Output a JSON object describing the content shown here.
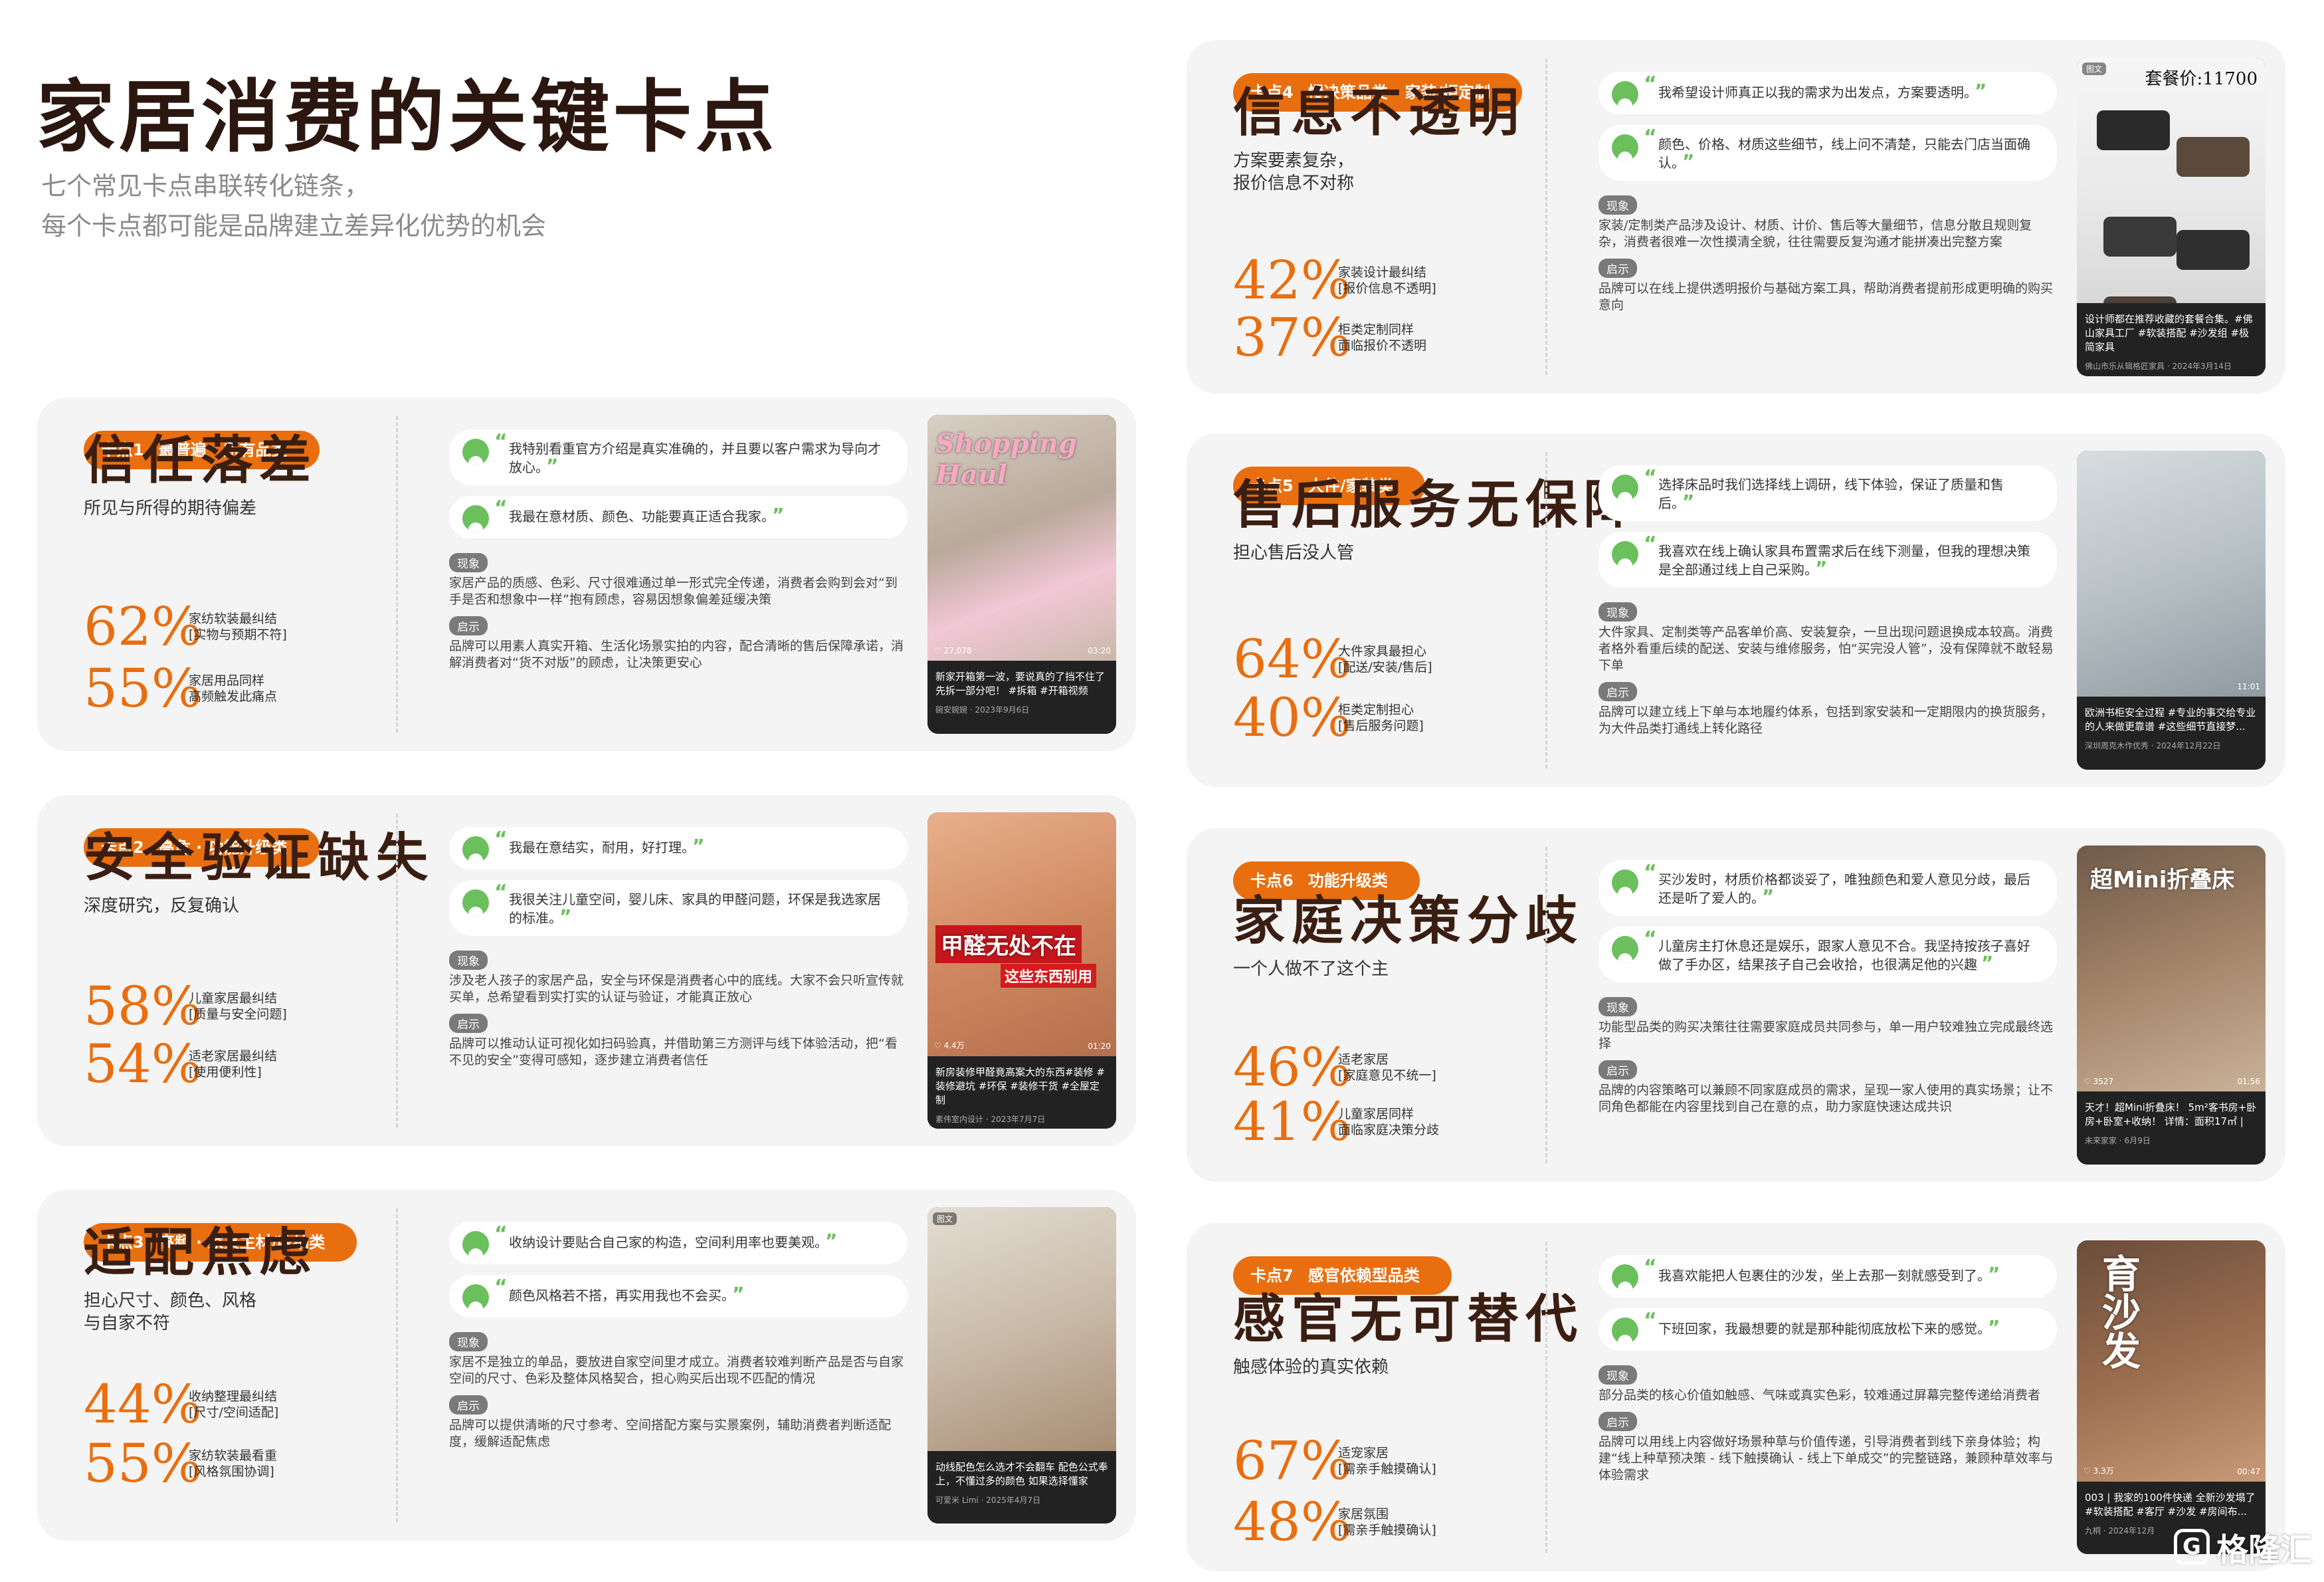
{
  "header": {
    "title": "家居消费的关键卡点",
    "subtitle_line1": "七个常见卡点串联转化链条，",
    "subtitle_line2": "每个卡点都可能是品牌建立差异化优势的机会"
  },
  "labels": {
    "phenomenon": "现象",
    "insight": "启示"
  },
  "cards": [
    {
      "tag_num": "卡点1",
      "tag_cat": "最普遍 · 所有品类",
      "name": "信任落差",
      "sub": "所见与所得的期待偏差",
      "stats": [
        {
          "pct": "62%",
          "desc": "家纺软装最纠结\n[实物与预期不符]"
        },
        {
          "pct": "55%",
          "desc": "家居用品同样\n高频触发此痛点"
        }
      ],
      "quotes": [
        "我特别看重官方介绍是真实准确的，并且要以客户需求为导向才放心。",
        "我最在意材质、颜色、功能要真正适合我家。"
      ],
      "phenomenon": "家居产品的质感、色彩、尺寸很难通过单一形式完全传递，消费者会购到会对“到手是否和想象中一样”抱有顾虑，容易因想象偏差延缓决策",
      "insight": "品牌可以用素人真实开箱、生活化场景实拍的内容，配合清晰的售后保障承诺，消解消费者对“货不对版”的顾虑，让决策更安心",
      "thumb": {
        "overlay": "Shopping Haul",
        "caption": "新家开箱第一波，要说真的了挡不住了先拆一部分吧！ #拆箱 #开箱视频",
        "meta": "碗安婉婉 · 2023年9月6日",
        "duration": "03:20",
        "likes": "27,078"
      }
    },
    {
      "tag_num": "卡点2",
      "tag_cat": "高危 · 功能升级类",
      "name": "安全验证缺失",
      "sub": "深度研究，反复确认",
      "stats": [
        {
          "pct": "58%",
          "desc": "儿童家居最纠结\n[质量与安全问题]"
        },
        {
          "pct": "54%",
          "desc": "适老家居最纠结\n[使用便利性]"
        }
      ],
      "quotes": [
        "我最在意结实，耐用，好打理。",
        "我很关注儿童空间，婴儿床、家具的甲醛问题，环保是我选家居的标准。"
      ],
      "phenomenon": "涉及老人孩子的家居产品，安全与环保是消费者心中的底线。大家不会只听宣传就买单，总希望看到实打实的认证与验证，才能真正放心",
      "insight": "品牌可以推动认证可视化如扫码验真，并借助第三方测评与线下体验活动，把“看不见的安全”变得可感知，逐步建立消费者信任",
      "thumb": {
        "overlay": "甲醛无处不在",
        "overlay2": "这些东西别用",
        "caption": "新房装修甲醛竟高案大的东西#装修 #装修避坑 #环保 #装修干货 #全屋定制",
        "meta": "素伟室内设计 · 2023年7月7日",
        "duration": "01:20",
        "likes": "4.4万"
      }
    },
    {
      "tag_num": "卡点3",
      "tag_cat": "高频 · 家具主材/收纳类",
      "name": "适配焦虑",
      "sub": "担心尺寸、颜色、风格\n与自家不符",
      "stats": [
        {
          "pct": "44%",
          "desc": "收纳整理最纠结\n[尺寸/空间适配]"
        },
        {
          "pct": "55%",
          "desc": "家纺软装最看重\n[风格氛围协调]"
        }
      ],
      "quotes": [
        "收纳设计要贴合自己家的构造，空间利用率也要美观。",
        "颜色风格若不搭，再实用我也不会买。"
      ],
      "phenomenon": "家居不是独立的单品，要放进自家空间里才成立。消费者较难判断产品是否与自家空间的尺寸、色彩及整体风格契合，担心购买后出现不匹配的情况",
      "insight": "品牌可以提供清晰的尺寸参考、空间搭配方案与实景案例，辅助消费者判断适配度，缓解适配焦虑",
      "thumb": {
        "badge": "图文",
        "caption": "动线配色怎么选才不会翻车 配色公式奉上，不懂过多的颜色 如果选择懂家",
        "meta": "可爱米 Limi · 2025年4月7日",
        "duration": "",
        "likes": ""
      }
    },
    {
      "tag_num": "卡点4",
      "tag_cat": "慢决策品类 · 家装/柜定制",
      "name": "信息不透明",
      "sub": "方案要素复杂，\n报价信息不对称",
      "stats": [
        {
          "pct": "42%",
          "desc": "家装设计最纠结\n[报价信息不透明]"
        },
        {
          "pct": "37%",
          "desc": "柜类定制同样\n面临报价不透明"
        }
      ],
      "quotes": [
        "我希望设计师真正以我的需求为出发点，方案要透明。",
        "颜色、价格、材质这些细节，线上问不清楚，只能去门店当面确认。"
      ],
      "phenomenon": "家装/定制类产品涉及设计、材质、计价、售后等大量细节，信息分散且规则复杂，消费者很难一次性摸清全貌，往往需要反复沟通才能拼凑出完整方案",
      "insight": "品牌可以在线上提供透明报价与基础方案工具，帮助消费者提前形成更明确的购买意向",
      "thumb": {
        "badge": "图文",
        "price": "套餐价:11700",
        "caption": "设计师都在推荐收藏的套餐合集。#佛山家具工厂 #软装搭配 #沙发组 #极简家具",
        "meta": "佛山市乐从辑格匠家具 · 2024年3月14日",
        "duration": "",
        "likes": ""
      }
    },
    {
      "tag_num": "卡点5",
      "tag_cat": "大件/家装类",
      "name": "售后服务无保障",
      "sub": "担心售后没人管",
      "stats": [
        {
          "pct": "64%",
          "desc": "大件家具最担心\n[配送/安装/售后]"
        },
        {
          "pct": "40%",
          "desc": "柜类定制担心\n[售后服务问题]"
        }
      ],
      "quotes": [
        "选择床品时我们选择线上调研，线下体验，保证了质量和售后。",
        "我喜欢在线上确认家具布置需求后在线下测量，但我的理想决策是全部通过线上自己采购。"
      ],
      "phenomenon": "大件家具、定制类等产品客单价高、安装复杂，一旦出现问题退换成本较高。消费者格外看重后续的配送、安装与维修服务，怕“买完没人管”，没有保障就不敢轻易下单",
      "insight": "品牌可以建立线上下单与本地履约体系，包括到家安装和一定期限内的换货服务，为大件品类打通线上转化路径",
      "thumb": {
        "caption": "欧洲书柜安全过程 #专业的事交给专业的人来做更靠谱 #这些细节直接梦...",
        "meta": "深圳周克木作优秀 · 2024年12月22日",
        "duration": "11:01",
        "likes": ""
      }
    },
    {
      "tag_num": "卡点6",
      "tag_cat": "功能升级类",
      "name": "家庭决策分歧",
      "sub": "一个人做不了这个主",
      "stats": [
        {
          "pct": "46%",
          "desc": "适老家居\n[家庭意见不统一]"
        },
        {
          "pct": "41%",
          "desc": "儿童家居同样\n面临家庭决策分歧"
        }
      ],
      "quotes": [
        "买沙发时，材质价格都谈妥了，唯独颜色和爱人意见分歧，最后还是听了爱人的。",
        "儿童房主打休息还是娱乐，跟家人意见不合。我坚持按孩子喜好做了手办区，结果孩子自己会收拾，也很满足他的兴趣"
      ],
      "phenomenon": "功能型品类的购买决策往往需要家庭成员共同参与，单一用户较难独立完成最终选择",
      "insight": "品牌的内容策略可以兼顾不同家庭成员的需求，呈现一家人使用的真实场景；让不同角色都能在内容里找到自己在意的点，助力家庭快速达成共识",
      "thumb": {
        "overlay": "超Mini折叠床",
        "caption": "天才！超Mini折叠床！ 5m²客书房+卧房+卧室+收纳！ 详情：面积17㎡ |",
        "meta": "未来家家 · 6月9日",
        "duration": "01:56",
        "likes": "3527"
      }
    },
    {
      "tag_num": "卡点7",
      "tag_cat": "感官依赖型品类",
      "name": "感官无可替代",
      "sub": "触感体验的真实依赖",
      "stats": [
        {
          "pct": "67%",
          "desc": "适宠家居\n[需亲手触摸确认]"
        },
        {
          "pct": "48%",
          "desc": "家居氛围\n[需亲手触摸确认]"
        }
      ],
      "quotes": [
        "我喜欢能把人包裹住的沙发，坐上去那一刻就感受到了。",
        "下班回家，我最想要的就是那种能彻底放松下来的感觉。"
      ],
      "phenomenon": "部分品类的核心价值如触感、气味或真实色彩，较难通过屏幕完整传递给消费者",
      "insight": "品牌可以用线上内容做好场景种草与价值传递，引导消费者到线下亲身体验；构建“线上种草预决策 - 线下触摸确认 - 线上下单成交”的完整链路，兼顾种草效率与体验需求",
      "thumb": {
        "overlay": "育沙发",
        "caption": "003 | 我家的100件快递 全新沙发塌了 #软装搭配 #客厅 #沙发 #房间布...",
        "meta": "九桐 · 2024年12月",
        "duration": "00:47",
        "likes": "3.3万"
      }
    }
  ],
  "watermark": "格隆汇",
  "colors": {
    "accent": "#e86e0f",
    "title": "#2b1710",
    "card_bg": "#f4f4f4",
    "avatar": "#6cbf5d"
  }
}
